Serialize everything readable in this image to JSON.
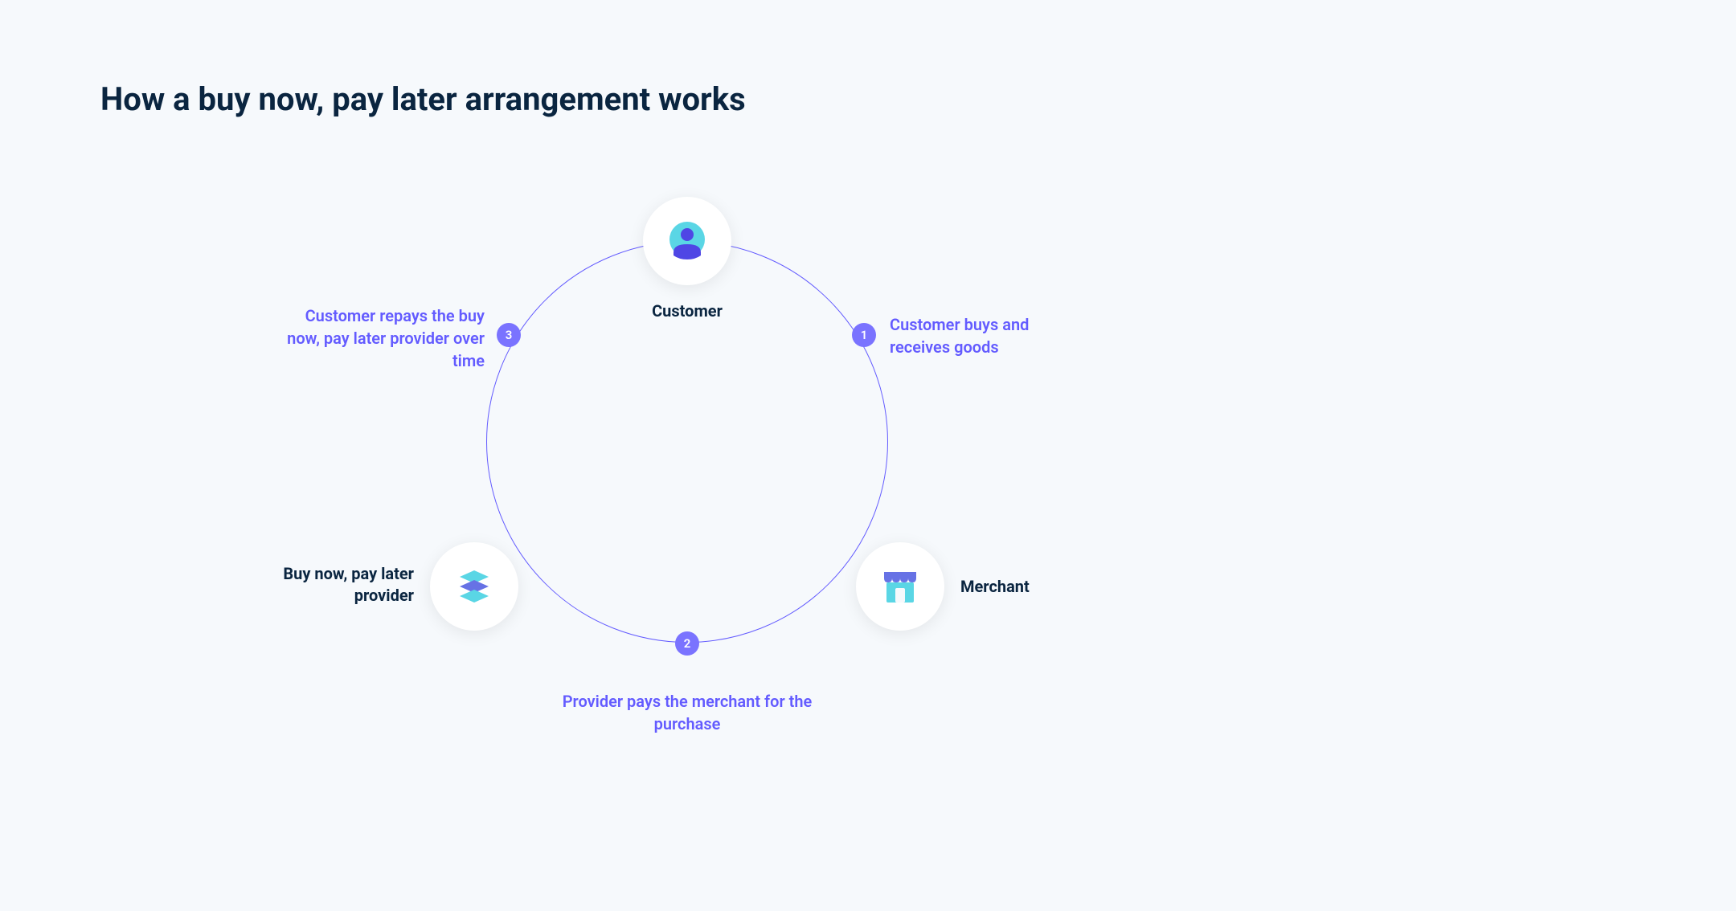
{
  "title": "How a buy now, pay later arrangement works",
  "nodes": {
    "customer": "Customer",
    "merchant": "Merchant",
    "provider": "Buy now, pay later provider"
  },
  "steps": {
    "step1": {
      "number": "1",
      "text": "Customer buys and receives goods"
    },
    "step2": {
      "number": "2",
      "text": "Provider pays the merchant for the purchase"
    },
    "step3": {
      "number": "3",
      "text": "Customer repays the buy now, pay later provider over time"
    }
  },
  "colors": {
    "background": "#f6f9fc",
    "title": "#0a2540",
    "accent": "#635bff",
    "badge": "#7a73ff",
    "cyan": "#5ad6e5",
    "purple": "#6772e5"
  }
}
